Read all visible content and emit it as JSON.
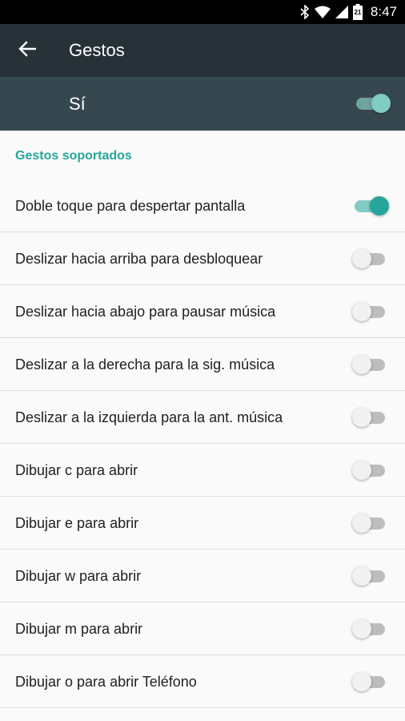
{
  "status_bar": {
    "time": "8:47",
    "battery_level": "21",
    "icons": [
      "bluetooth-icon",
      "wifi-icon",
      "cell-signal-icon",
      "battery-icon"
    ]
  },
  "app_bar": {
    "title": "Gestos",
    "back_icon": "arrow-left-icon"
  },
  "master": {
    "label": "Sí",
    "enabled": true
  },
  "section": {
    "title": "Gestos soportados"
  },
  "gestures": [
    {
      "label": "Doble toque para despertar pantalla",
      "enabled": true
    },
    {
      "label": "Deslizar hacia arriba para desbloquear",
      "enabled": false
    },
    {
      "label": "Deslizar hacia abajo para pausar música",
      "enabled": false
    },
    {
      "label": "Deslizar a la derecha para la sig. música",
      "enabled": false
    },
    {
      "label": "Deslizar a la izquierda para la ant. música",
      "enabled": false
    },
    {
      "label": "Dibujar c para abrir",
      "enabled": false
    },
    {
      "label": "Dibujar e para abrir",
      "enabled": false
    },
    {
      "label": "Dibujar w para abrir",
      "enabled": false
    },
    {
      "label": "Dibujar m para abrir",
      "enabled": false
    },
    {
      "label": "Dibujar o para abrir Teléfono",
      "enabled": false
    }
  ],
  "colors": {
    "app_bar": "#263238",
    "master_bar": "#37474f",
    "accent": "#26a69a",
    "background": "#fafafa"
  }
}
